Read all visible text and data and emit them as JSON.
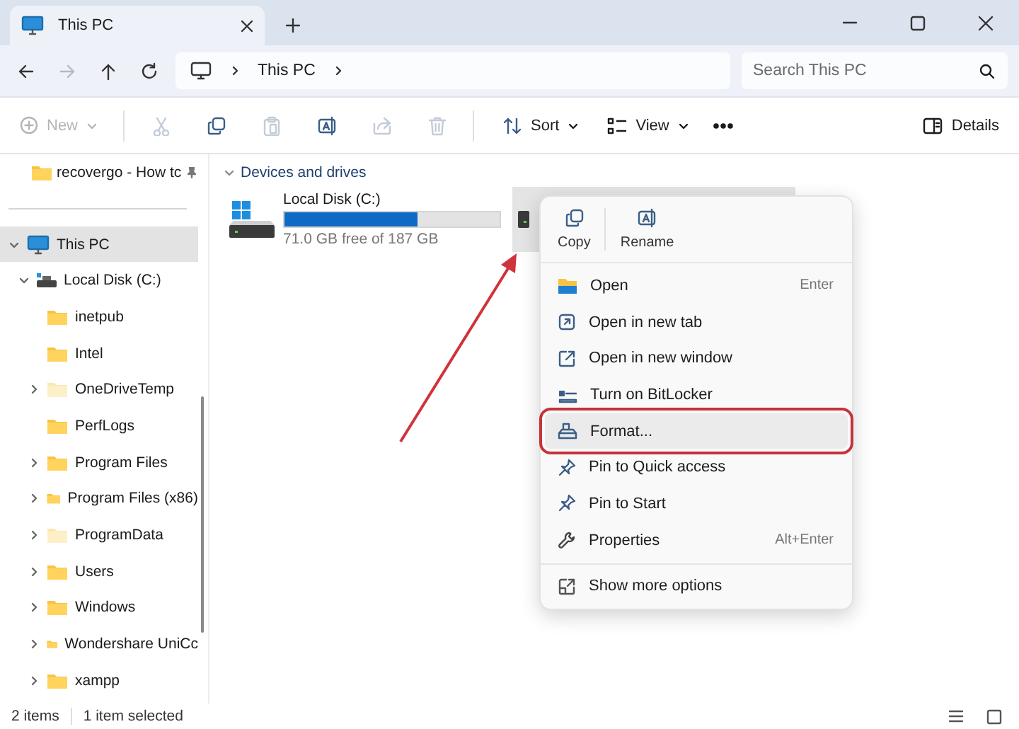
{
  "tabs": [
    {
      "label": "This PC",
      "selected": true
    }
  ],
  "nav_buttons": [
    {
      "disabled": false
    },
    {
      "disabled": true
    },
    {
      "disabled": false
    },
    {
      "disabled": false
    }
  ],
  "address": {
    "path": [
      "This PC"
    ]
  },
  "search": {
    "placeholder": "Search This PC"
  },
  "command_bar": {
    "new": {
      "label": "New",
      "disabled": true
    },
    "edit_buttons": [
      {
        "disabled": true
      },
      {
        "disabled": false
      },
      {
        "disabled": true
      },
      {
        "disabled": false
      },
      {
        "disabled": true
      },
      {
        "disabled": true
      }
    ],
    "sort": {
      "label": "Sort"
    },
    "view": {
      "label": "View"
    },
    "details": {
      "label": "Details"
    }
  },
  "sidebar": {
    "pinned": [
      {
        "label": "recovergo - How tc",
        "pinned": true
      }
    ],
    "tree": [
      {
        "kind": "pc",
        "label": "This PC",
        "selected": true,
        "expanded": true,
        "children": [
          {
            "kind": "drive",
            "label": "Local Disk (C:)",
            "selected": false,
            "expanded": true,
            "children": [
              {
                "kind": "folder",
                "label": "inetpub",
                "selected": false,
                "hidden": false
              },
              {
                "kind": "folder",
                "label": "Intel",
                "selected": false,
                "hidden": false
              },
              {
                "kind": "folder",
                "label": "OneDriveTemp",
                "selected": false,
                "hidden": true,
                "expanded": false
              },
              {
                "kind": "folder",
                "label": "PerfLogs",
                "selected": false,
                "hidden": false
              },
              {
                "kind": "folder",
                "label": "Program Files",
                "selected": false,
                "hidden": false,
                "expanded": false
              },
              {
                "kind": "folder",
                "label": "Program Files (x86)",
                "selected": false,
                "hidden": false,
                "expanded": false
              },
              {
                "kind": "folder",
                "label": "ProgramData",
                "selected": false,
                "hidden": true,
                "expanded": false
              },
              {
                "kind": "folder",
                "label": "Users",
                "selected": false,
                "hidden": false,
                "expanded": false
              },
              {
                "kind": "folder",
                "label": "Windows",
                "selected": false,
                "hidden": false,
                "expanded": false
              },
              {
                "kind": "folder",
                "label": "Wondershare UniCc",
                "selected": false,
                "hidden": false,
                "expanded": false
              },
              {
                "kind": "folder",
                "label": "xampp",
                "selected": false,
                "hidden": false,
                "expanded": false
              }
            ]
          }
        ]
      }
    ]
  },
  "content": {
    "group": {
      "label": "Devices and drives",
      "expanded": true
    },
    "drives": [
      {
        "name": "Local Disk (C:)",
        "free": "71.0 GB free of 187 GB",
        "level": 0.62,
        "selected": false
      },
      {
        "selected": true
      }
    ]
  },
  "context_menu": {
    "quick_actions": [
      {
        "label": "Copy"
      },
      {
        "label": "Rename"
      }
    ],
    "sections": [
      [
        {
          "label": "Open",
          "shortcut": "Enter",
          "hovered": false,
          "annotated": false
        },
        {
          "label": "Open in new tab",
          "hovered": false,
          "annotated": false
        },
        {
          "label": "Open in new window",
          "hovered": false,
          "annotated": false
        },
        {
          "label": "Turn on BitLocker",
          "hovered": false,
          "annotated": false
        },
        {
          "label": "Format...",
          "hovered": true,
          "annotated": true
        },
        {
          "label": "Pin to Quick access",
          "hovered": false,
          "annotated": false
        },
        {
          "label": "Pin to Start",
          "hovered": false,
          "annotated": false
        },
        {
          "label": "Properties",
          "shortcut": "Alt+Enter",
          "hovered": false,
          "annotated": false
        }
      ],
      [
        {
          "label": "Show more options",
          "hovered": false,
          "annotated": false
        }
      ]
    ]
  },
  "annotation": {
    "arrow": true
  },
  "status_bar": {
    "item_count": "2 items",
    "selection": "1 item selected"
  }
}
